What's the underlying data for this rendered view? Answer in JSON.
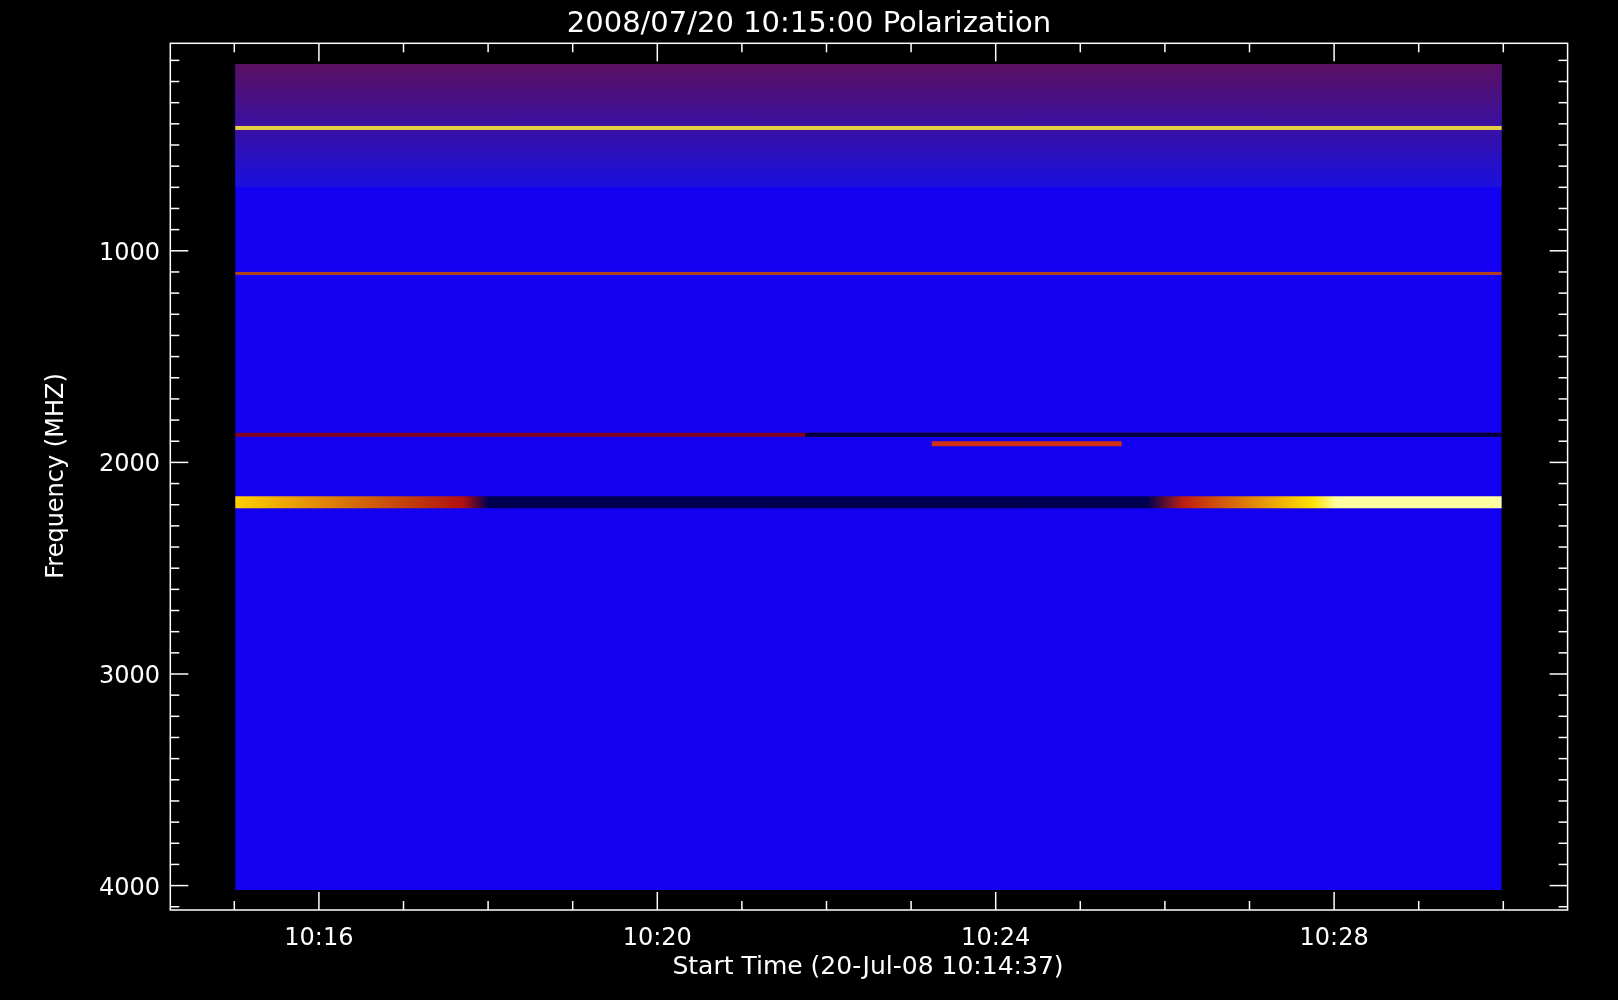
{
  "title": "2008/07/20 10:15:00 Polarization",
  "y_axis": {
    "label": "Frequency (MHZ)",
    "ticks": [
      "1000",
      "2000",
      "3000",
      "4000"
    ]
  },
  "x_axis": {
    "label": "Start Time (20-Jul-08 10:14:37)",
    "ticks": [
      "10:16",
      "10:20",
      "10:24",
      "10:28"
    ]
  }
}
